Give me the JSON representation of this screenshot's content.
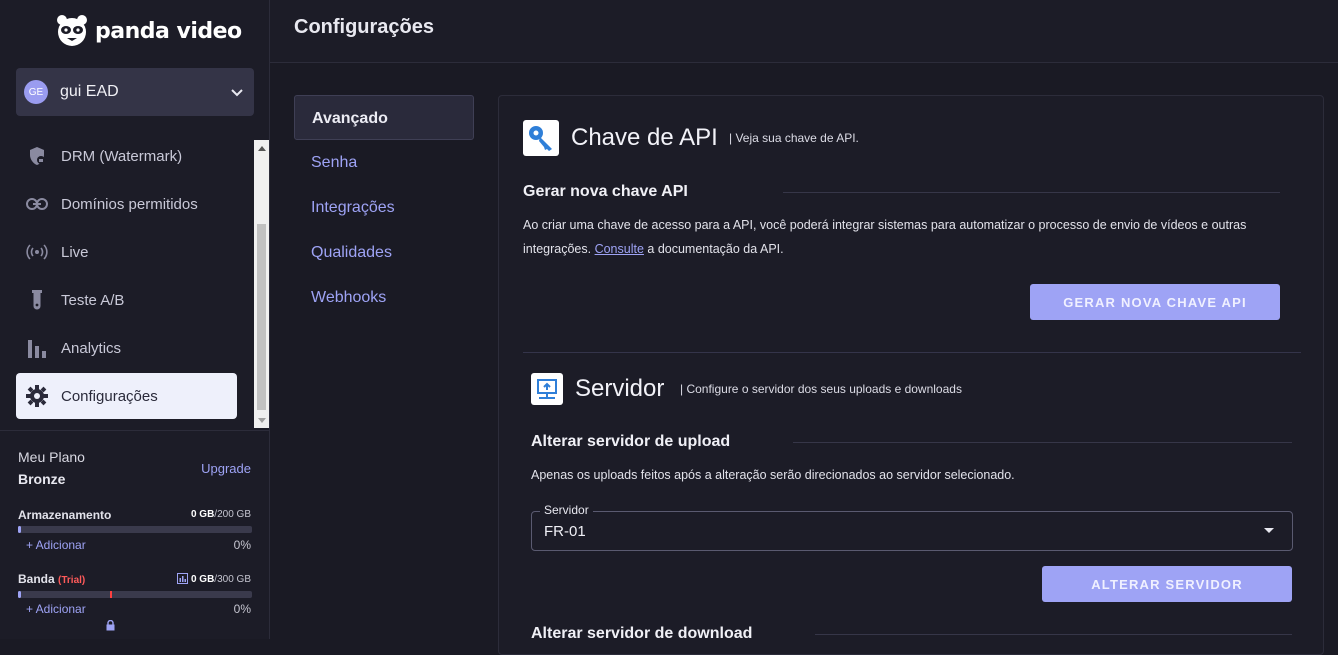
{
  "brand": {
    "logo_text": "panda video"
  },
  "account": {
    "initials": "GE",
    "name": "gui EAD"
  },
  "sidebar": {
    "items": [
      {
        "label": "DRM (Watermark)",
        "icon": "shield-lock-icon"
      },
      {
        "label": "Domínios permitidos",
        "icon": "link-icon"
      },
      {
        "label": "Live",
        "icon": "broadcast-icon"
      },
      {
        "label": "Teste A/B",
        "icon": "test-tube-icon"
      },
      {
        "label": "Analytics",
        "icon": "bar-chart-icon"
      },
      {
        "label": "Configurações",
        "icon": "gear-icon",
        "active": true
      }
    ]
  },
  "plan": {
    "label": "Meu Plano",
    "name": "Bronze",
    "upgrade": "Upgrade",
    "storage": {
      "title": "Armazenamento",
      "used": "0 GB",
      "total": "/200 GB",
      "add": "+ Adicionar",
      "percent": "0%",
      "fraction": 0.0
    },
    "bandwidth": {
      "title": "Banda",
      "badge": "(Trial)",
      "used": "0 GB",
      "total": "/300 GB",
      "add": "+ Adicionar",
      "percent": "0%",
      "fraction": 0.0
    }
  },
  "header": {
    "title": "Configurações"
  },
  "settings_menu": [
    {
      "label": "Avançado",
      "active": true
    },
    {
      "label": "Senha"
    },
    {
      "label": "Integrações"
    },
    {
      "label": "Qualidades"
    },
    {
      "label": "Webhooks"
    }
  ],
  "api": {
    "title": "Chave de API",
    "subtitle": "| Veja sua chave de API.",
    "heading": "Gerar nova chave API",
    "desc_1": "Ao criar uma chave de acesso para a API, você poderá integrar sistemas para automatizar o processo de envio de vídeos e outras",
    "desc_2a": "integrações. ",
    "desc_link": "Consulte",
    "desc_2b": " a documentação da API.",
    "button": "GERAR NOVA CHAVE API"
  },
  "server": {
    "title": "Servidor",
    "subtitle": "| Configure o servidor dos seus uploads e downloads",
    "upload_heading": "Alterar servidor de upload",
    "upload_desc": "Apenas os uploads feitos após a alteração serão direcionados ao servidor selecionado.",
    "select_label": "Servidor",
    "select_value": "FR-01",
    "button": "ALTERAR SERVIDOR",
    "download_heading": "Alterar servidor de download"
  },
  "colors": {
    "accent": "#9ea3f5",
    "background": "#1a1a24",
    "panel": "#1c1c27"
  }
}
